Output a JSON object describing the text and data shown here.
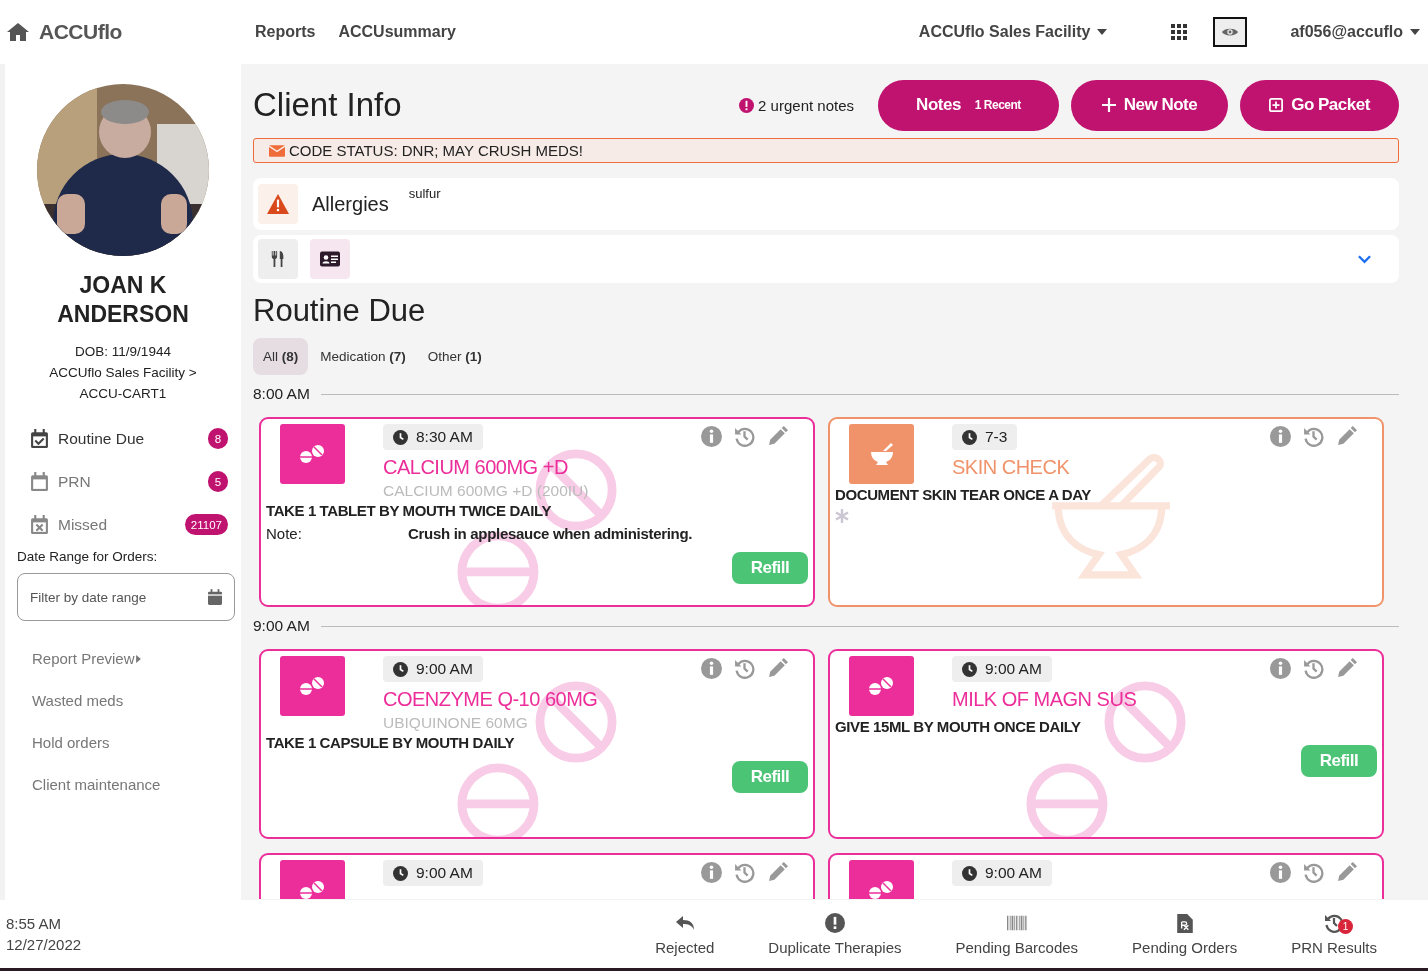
{
  "nav": {
    "brand": "ACCUflo",
    "links": [
      "Reports",
      "ACCUsummary"
    ],
    "facility": "ACCUflo Sales Facility",
    "user": "af056@accuflo"
  },
  "client": {
    "name": "JOAN K ANDERSON",
    "dob": "DOB: 11/9/1944",
    "location": "ACCUflo Sales Facility >",
    "cart": "ACCU-CART1"
  },
  "sidebar": {
    "items": [
      {
        "label": "Routine Due",
        "count": "8",
        "kind": "due"
      },
      {
        "label": "PRN",
        "count": "5",
        "kind": "prn"
      },
      {
        "label": "Missed",
        "count": "21107",
        "kind": "missed"
      }
    ],
    "date_range": {
      "label": "Date Range for Orders:",
      "placeholder": "Filter by date range"
    },
    "links": [
      {
        "label": "Report Preview",
        "kind": "submenu"
      },
      {
        "label": "Wasted meds",
        "kind": "link"
      },
      {
        "label": "Hold orders",
        "kind": "link"
      },
      {
        "label": "Client maintenance",
        "kind": "link"
      }
    ]
  },
  "header": {
    "title": "Client Info",
    "urgent": "2 urgent notes",
    "buttons": [
      {
        "label": "Notes",
        "badge": "1 Recent",
        "kind": "notes"
      },
      {
        "label": "New Note",
        "kind": "new"
      },
      {
        "label": "Go Packet",
        "kind": "packet"
      }
    ]
  },
  "alert": "CODE STATUS: DNR; MAY CRUSH MEDS!",
  "allergies": {
    "label": "Allergies",
    "value": "sulfur"
  },
  "routine": {
    "title": "Routine Due",
    "filters": [
      {
        "label": "All **(8)**",
        "selected": true
      },
      {
        "label": "Medication **(7)**",
        "selected": false
      },
      {
        "label": "Other **(1)**",
        "selected": false
      }
    ]
  },
  "groups": [
    {
      "time": "8:00 AM",
      "cards": [
        {
          "kind": "medication",
          "time": "8:30 AM",
          "title": "CALCIUM 600MG +D",
          "generic": "CALCIUM 600MG +D (200IU)",
          "directions": "TAKE 1 TABLET BY MOUTH TWICE DAILY",
          "note_label": "Note:",
          "note": "Crush in applesauce when administering.",
          "refill": "Refill"
        },
        {
          "kind": "treatment",
          "time": "7-3",
          "title": "SKIN CHECK",
          "directions": "DOCUMENT SKIN TEAR ONCE A DAY"
        }
      ]
    },
    {
      "time": "9:00 AM",
      "cards": [
        {
          "kind": "medication",
          "time": "9:00 AM",
          "title": "COENZYME Q-10 60MG",
          "generic": "UBIQUINONE 60MG",
          "directions": "TAKE 1 CAPSULE BY MOUTH DAILY",
          "refill": "Refill"
        },
        {
          "kind": "medication",
          "time": "9:00 AM",
          "title": "MILK OF MAGN SUS",
          "directions": "GIVE 15ML BY MOUTH ONCE DAILY",
          "refill": "Refill"
        },
        {
          "kind": "medication",
          "time": "9:00 AM"
        },
        {
          "kind": "medication",
          "time": "9:00 AM"
        }
      ]
    }
  ],
  "status_bar": {
    "time": "8:55 AM",
    "date": "12/27/2022",
    "actions": [
      {
        "label": "Rejected",
        "kind": "rejected"
      },
      {
        "label": "Duplicate Therapies",
        "kind": "duplicate"
      },
      {
        "label": "Pending Barcodes",
        "kind": "barcodes"
      },
      {
        "label": "Pending Orders",
        "kind": "orders"
      },
      {
        "label": "PRN Results",
        "kind": "prn",
        "badge": "1"
      }
    ]
  }
}
